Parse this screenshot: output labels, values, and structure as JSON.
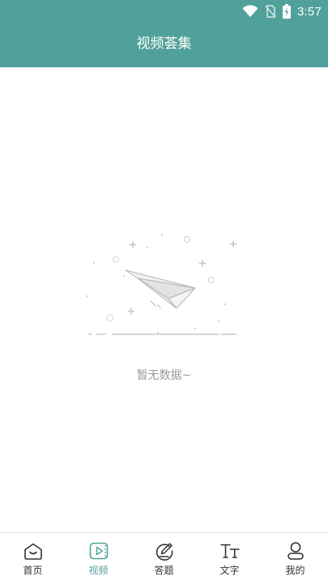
{
  "status": {
    "time": "3:57",
    "icons": [
      "wifi-icon",
      "no-sim-icon",
      "battery-charging-icon"
    ]
  },
  "header": {
    "title": "视频荟集",
    "background_color": "#51a19b"
  },
  "empty_state": {
    "illustration_icon": "paper-plane-icon",
    "text": "暂无数据~"
  },
  "tabbar": {
    "active_color": "#51a19b",
    "tabs": [
      {
        "label": "首页",
        "icon": "home-icon",
        "active": false
      },
      {
        "label": "视频",
        "icon": "video-icon",
        "active": true
      },
      {
        "label": "答题",
        "icon": "edit-icon",
        "active": false
      },
      {
        "label": "文字",
        "icon": "text-icon",
        "active": false
      },
      {
        "label": "我的",
        "icon": "user-icon",
        "active": false
      }
    ]
  }
}
